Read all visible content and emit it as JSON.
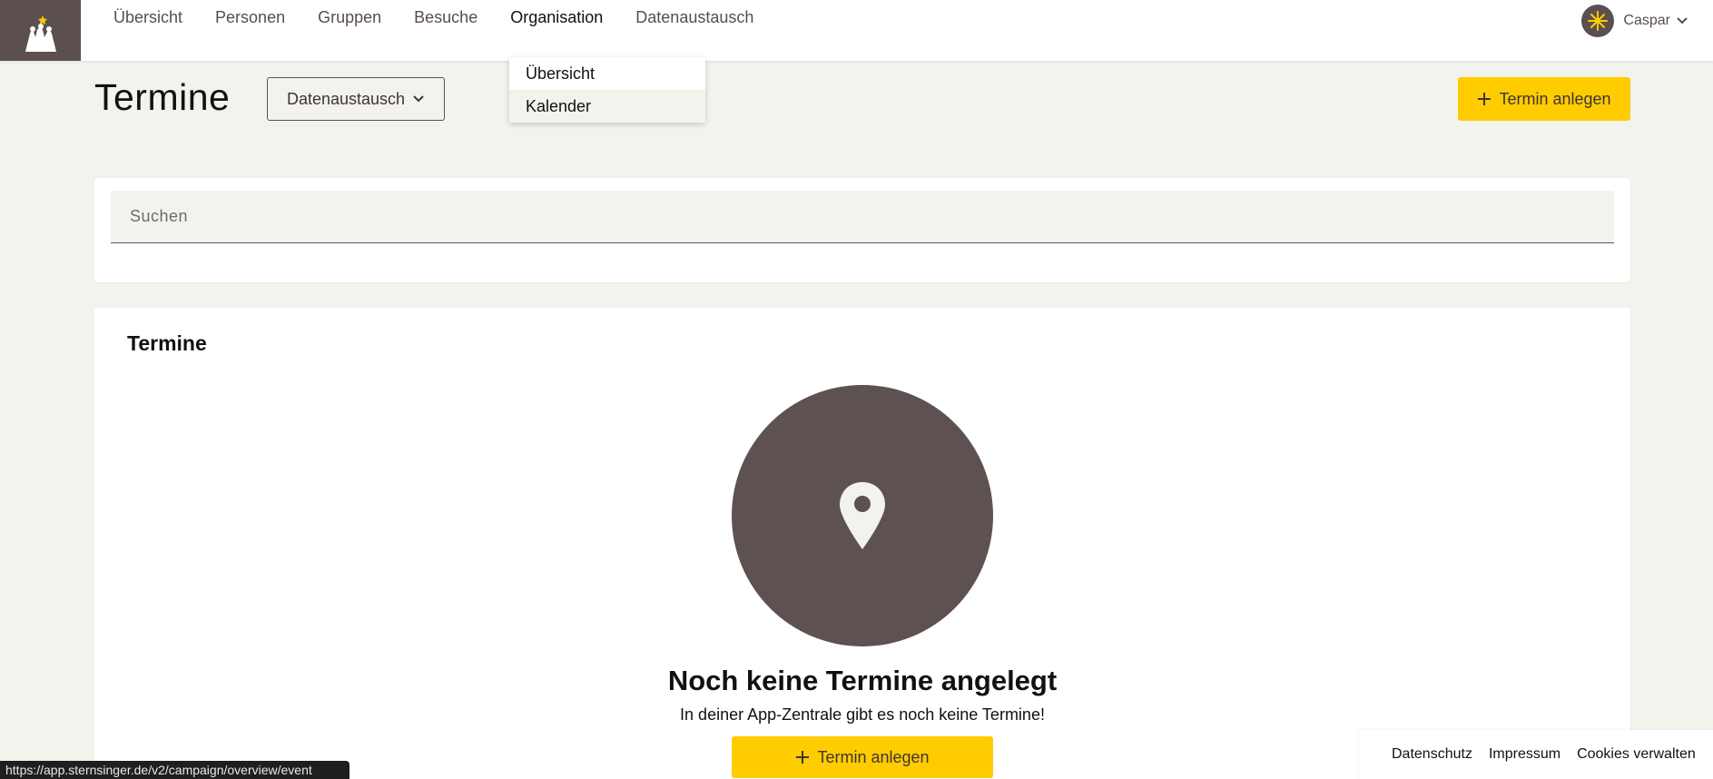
{
  "nav": {
    "items": [
      {
        "label": "Übersicht"
      },
      {
        "label": "Personen"
      },
      {
        "label": "Gruppen"
      },
      {
        "label": "Besuche"
      },
      {
        "label": "Organisation"
      },
      {
        "label": "Datenaustausch"
      }
    ],
    "active": "Organisation"
  },
  "user": {
    "name": "Caspar"
  },
  "dropdown": {
    "items": [
      {
        "label": "Übersicht"
      },
      {
        "label": "Kalender"
      }
    ]
  },
  "page": {
    "title": "Termine",
    "select_label": "Datenaustausch",
    "add_button": "Termin anlegen"
  },
  "search": {
    "placeholder": "Suchen"
  },
  "events": {
    "title": "Termine",
    "empty_title": "Noch keine Termine angelegt",
    "empty_text": "In deiner App-Zentrale gibt es noch keine Termine!",
    "add_button": "Termin anlegen"
  },
  "footer": {
    "links": [
      {
        "label": "Datenschutz"
      },
      {
        "label": "Impressum"
      },
      {
        "label": "Cookies verwalten"
      }
    ]
  },
  "status_url": "https://app.sternsinger.de/v2/campaign/overview/event",
  "colors": {
    "accent": "#ffcc00",
    "brand_brown": "#5c4f4f",
    "background": "#f3f3ed"
  },
  "icons": {
    "logo": "three-kings-logo",
    "avatar": "star-icon",
    "empty_state": "map-pin-icon"
  }
}
